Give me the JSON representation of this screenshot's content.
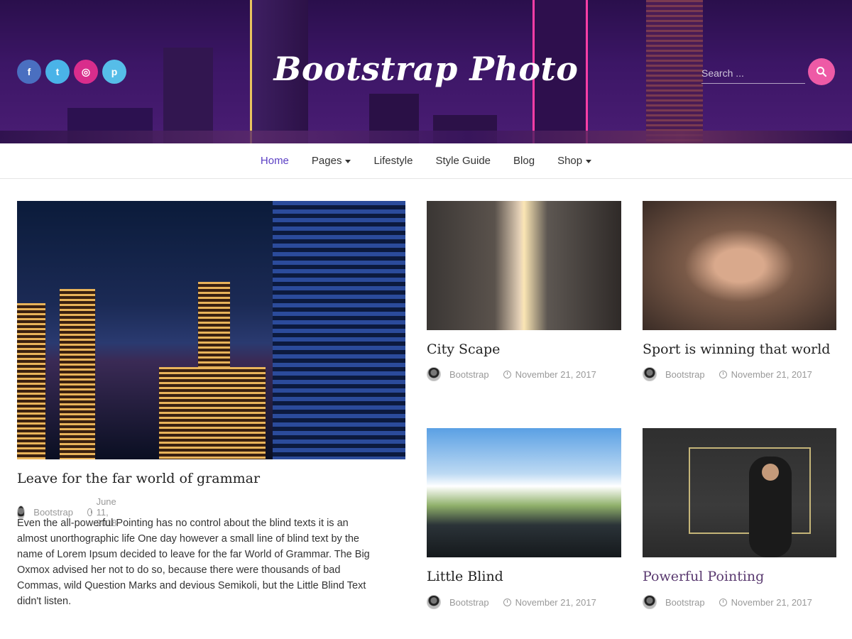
{
  "header": {
    "site_title": "Bootstrap Photo",
    "social": [
      {
        "icon": "facebook-icon",
        "glyph": "f"
      },
      {
        "icon": "twitter-icon",
        "glyph": "t"
      },
      {
        "icon": "instagram-icon",
        "glyph": "◎"
      },
      {
        "icon": "pinterest-icon",
        "glyph": "p"
      }
    ],
    "search": {
      "placeholder": "Search ..."
    }
  },
  "nav": {
    "items": [
      {
        "label": "Home",
        "active": true
      },
      {
        "label": "Pages",
        "dropdown": true
      },
      {
        "label": "Lifestyle"
      },
      {
        "label": "Style Guide"
      },
      {
        "label": "Blog"
      },
      {
        "label": "Shop",
        "dropdown": true
      }
    ]
  },
  "featured": {
    "title": "Leave for the far world of grammar",
    "author": "Bootstrap",
    "date": "June 11, 2018",
    "excerpt_lines": [
      "Even the all-powerful Pointing has no control about the blind texts it is an",
      "almost unorthographic life One day however a small line of blind text by the",
      "name of Lorem Ipsum decided to leave for the far World of Grammar. The Big",
      "Oxmox advised her not to do so, because there were thousands of bad",
      "Commas, wild Question Marks and devious Semikoli, but the Little Blind Text",
      "didn't listen."
    ]
  },
  "posts": [
    {
      "title": "City Scape",
      "author": "Bootstrap",
      "date": "November 21, 2017"
    },
    {
      "title": "Sport is winning that world",
      "author": "Bootstrap",
      "date": "November 21, 2017"
    },
    {
      "title": "Little Blind",
      "author": "Bootstrap",
      "date": "November 21, 2017"
    },
    {
      "title": "Powerful Pointing",
      "author": "Bootstrap",
      "date": "November 21, 2017"
    }
  ],
  "colors": {
    "accent_nav_active": "#5b3fc4",
    "search_button": "#ee5aa6",
    "hero_bg": "#3c1666"
  }
}
